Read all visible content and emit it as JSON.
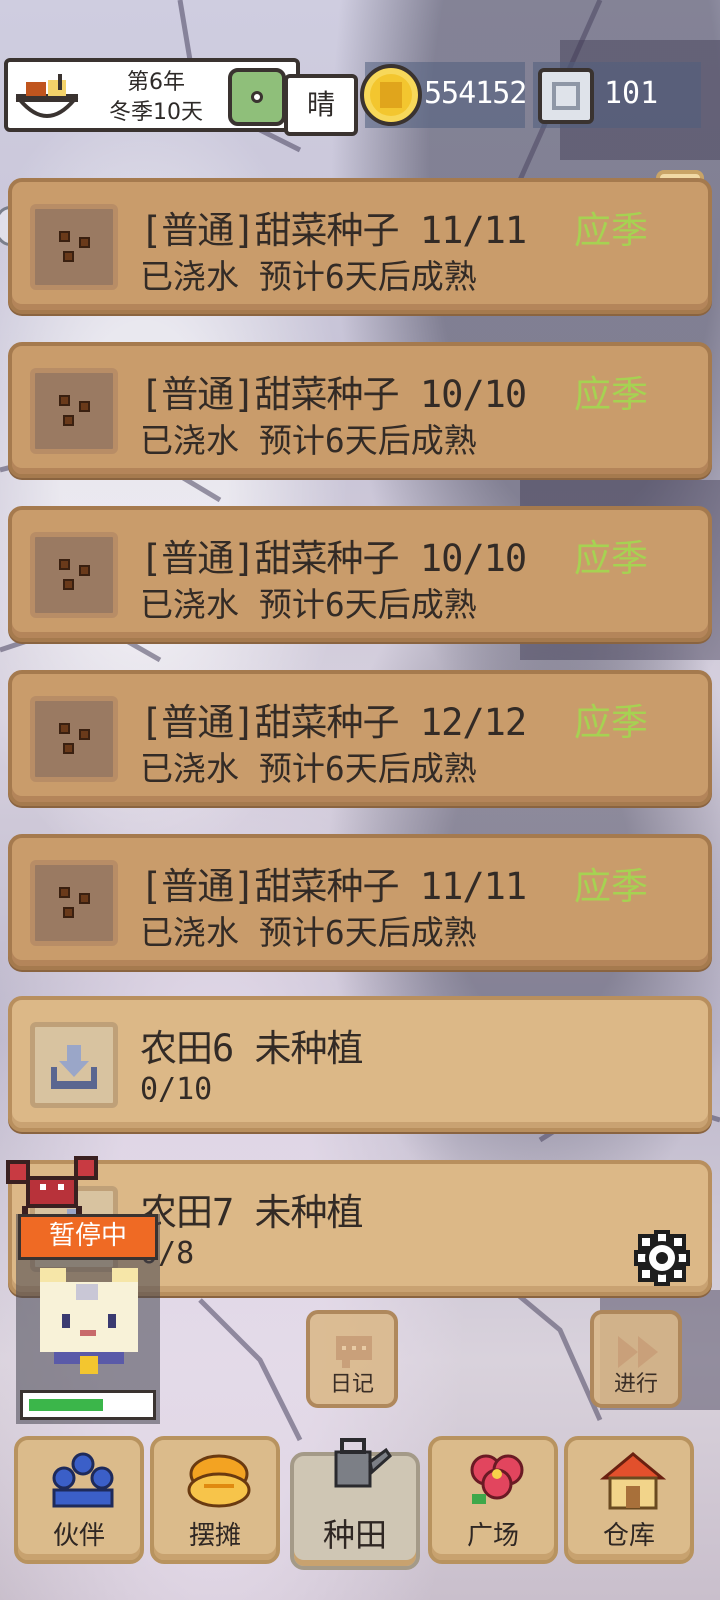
{
  "status_bar": {
    "year": "第6年",
    "day": "冬季10天",
    "weather": "晴",
    "coins": "554152",
    "gems": "101"
  },
  "fields": [
    {
      "name": "[普通]甜菜种子 11/11",
      "status": "已浇水 预计6天后成熟",
      "season_tag": "应季"
    },
    {
      "name": "[普通]甜菜种子 10/10",
      "status": "已浇水 预计6天后成熟",
      "season_tag": "应季"
    },
    {
      "name": "[普通]甜菜种子 10/10",
      "status": "已浇水 预计6天后成熟",
      "season_tag": "应季"
    },
    {
      "name": "[普通]甜菜种子 12/12",
      "status": "已浇水 预计6天后成熟",
      "season_tag": "应季"
    },
    {
      "name": "[普通]甜菜种子 11/11",
      "status": "已浇水 预计6天后成熟",
      "season_tag": "应季"
    }
  ],
  "empty_fields": [
    {
      "name": "农田6 未种植",
      "count": "0/10"
    },
    {
      "name": "农田7 未种植",
      "count": "0/8"
    }
  ],
  "help_label": "?",
  "paused_label": "暂停中",
  "progress_fraction": 0.6,
  "colors": {
    "season_tag": "#a6d252",
    "paused": "#ef6a24",
    "progress": "#3bb64a"
  },
  "actions": {
    "diary": "日记",
    "advance": "进行"
  },
  "nav": [
    {
      "label": "伙伴",
      "icon": "partners-icon"
    },
    {
      "label": "摆摊",
      "icon": "stall-icon"
    },
    {
      "label": "种田",
      "icon": "watering-can-icon",
      "active": true
    },
    {
      "label": "广场",
      "icon": "flower-icon"
    },
    {
      "label": "仓库",
      "icon": "warehouse-icon"
    }
  ]
}
